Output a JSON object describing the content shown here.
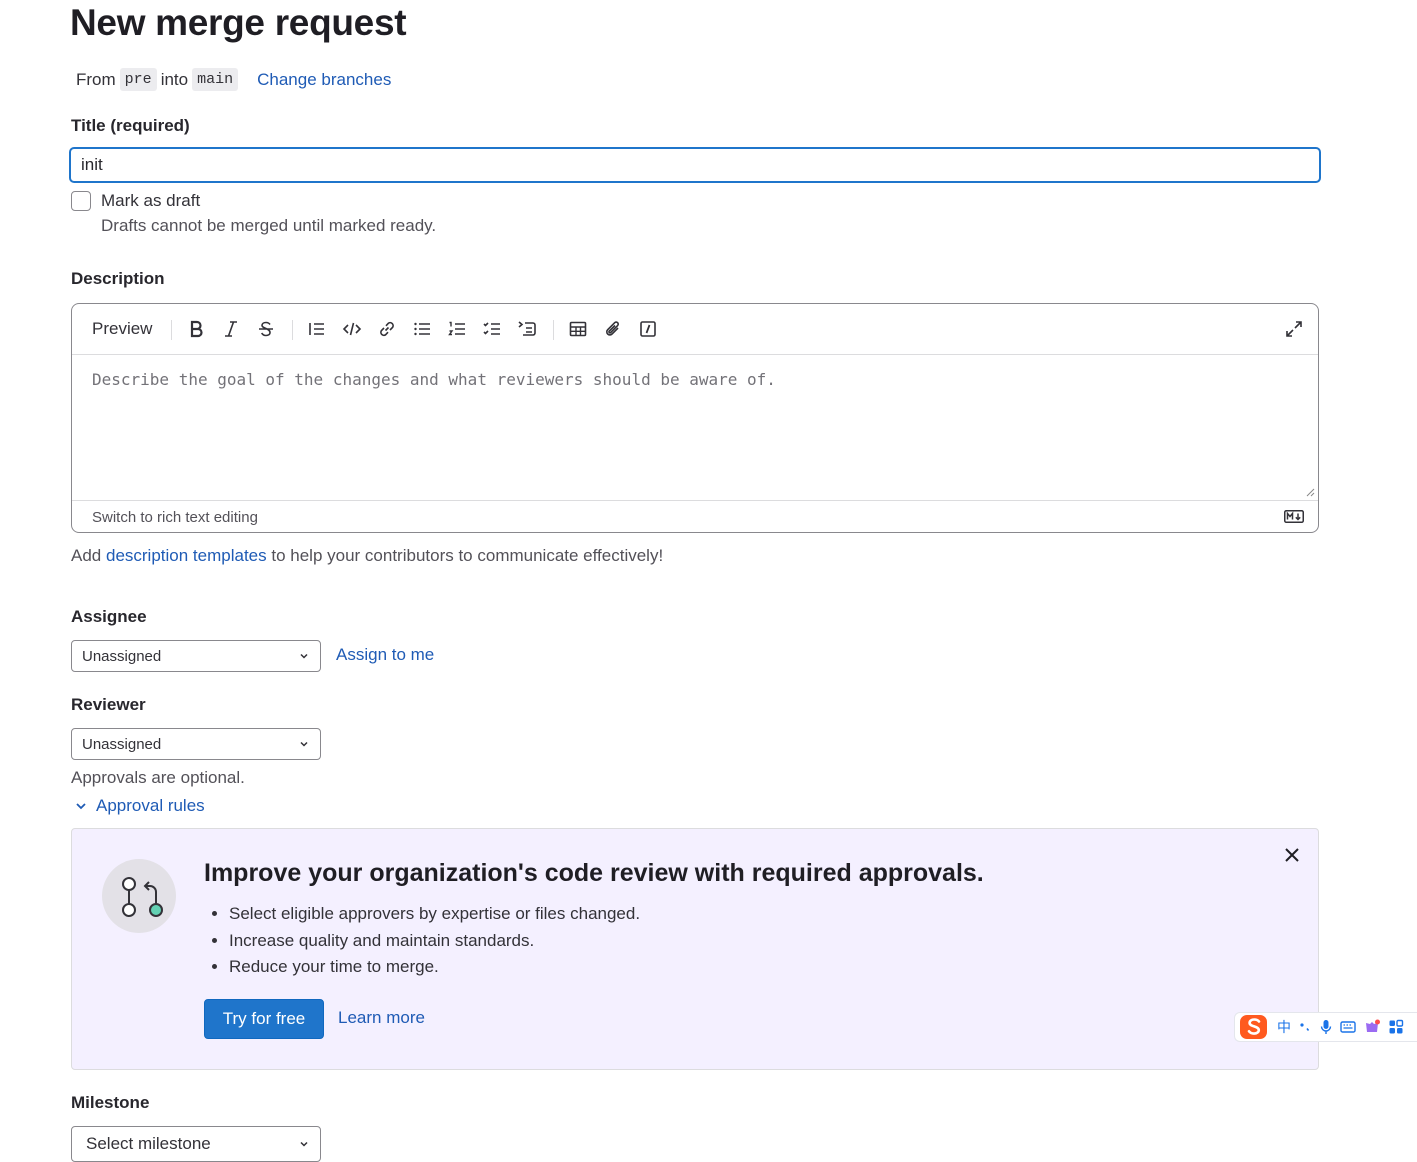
{
  "page": {
    "title": "New merge request"
  },
  "branches": {
    "from_label": "From",
    "source": "pre",
    "into_label": "into",
    "target": "main",
    "change_link": "Change branches"
  },
  "title_field": {
    "label": "Title (required)",
    "value": "init"
  },
  "draft": {
    "label": "Mark as draft",
    "help": "Drafts cannot be merged until marked ready.",
    "checked": false
  },
  "description": {
    "label": "Description",
    "toolbar": {
      "preview": "Preview",
      "buttons": [
        "bold-icon",
        "italic-icon",
        "strikethrough-icon",
        "quote-icon",
        "code-icon",
        "link-icon",
        "bullet-list-icon",
        "numbered-list-icon",
        "task-list-icon",
        "collapsible-section-icon",
        "table-icon",
        "attach-file-icon",
        "quick-actions-icon",
        "fullscreen-icon"
      ]
    },
    "placeholder": "Describe the goal of the changes and what reviewers should be aware of.",
    "switch_mode": "Switch to rich text editing",
    "markdown_badge": "markdown-icon"
  },
  "templates_line": {
    "prefix": "Add",
    "link": "description templates",
    "suffix": "to help your contributors to communicate effectively!"
  },
  "assignee": {
    "label": "Assignee",
    "value": "Unassigned",
    "assign_to_me": "Assign to me"
  },
  "reviewer": {
    "label": "Reviewer",
    "value": "Unassigned",
    "approvals_note": "Approvals are optional.",
    "approval_rules": "Approval rules"
  },
  "promo": {
    "title": "Improve your organization's code review with required approvals.",
    "bullets": [
      "Select eligible approvers by expertise or files changed.",
      "Increase quality and maintain standards.",
      "Reduce your time to merge."
    ],
    "primary_button": "Try for free",
    "secondary_link": "Learn more"
  },
  "milestone": {
    "label": "Milestone",
    "value": "Select milestone"
  },
  "ime": {
    "mode": "中"
  },
  "colors": {
    "link": "#1f5bb5",
    "primary": "#1f75cb",
    "promo_bg": "#f4f0ff",
    "focus": "#1f75cb"
  }
}
